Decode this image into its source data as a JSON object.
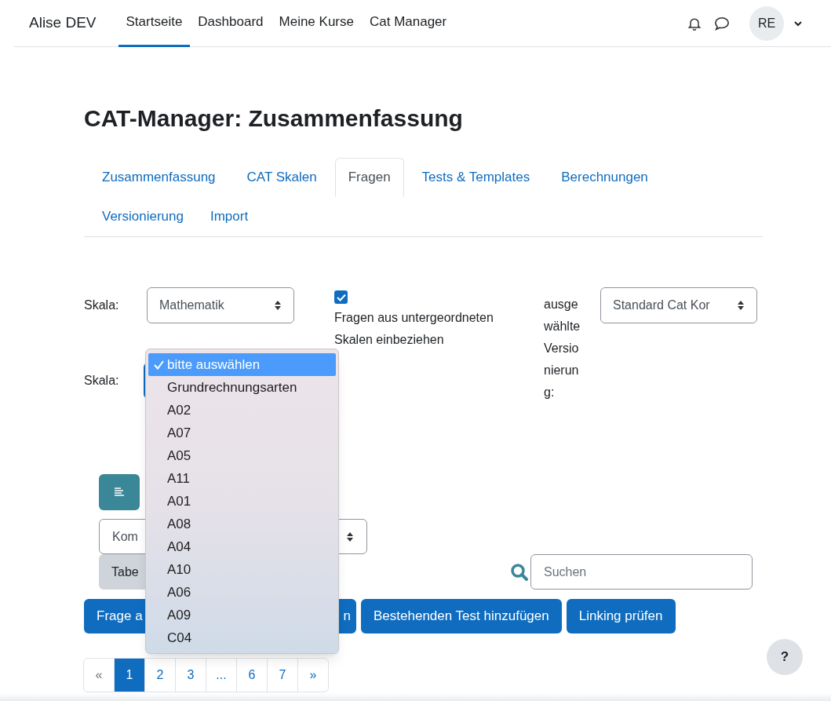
{
  "navbar": {
    "brand": "Alise DEV",
    "links": [
      {
        "label": "Startseite",
        "selected": true
      },
      {
        "label": "Dashboard",
        "selected": false
      },
      {
        "label": "Meine Kurse",
        "selected": false
      },
      {
        "label": "Cat Manager",
        "selected": false
      }
    ],
    "avatar": "RE"
  },
  "title": "CAT-Manager: Zusammenfassung",
  "tabs": [
    {
      "label": "Zusammenfassung",
      "selected": false
    },
    {
      "label": "CAT Skalen",
      "selected": false
    },
    {
      "label": "Fragen",
      "selected": true
    },
    {
      "label": "Tests & Templates",
      "selected": false
    },
    {
      "label": "Berechnungen",
      "selected": false
    },
    {
      "label": "Versionierung",
      "selected": false
    },
    {
      "label": "Import",
      "selected": false
    }
  ],
  "filters": {
    "scale_label": "Skala:",
    "scale_select": "Mathematik",
    "include_children": {
      "checked": true,
      "label": "Fragen aus untergeordneten Skalen einbeziehen"
    },
    "version_label": "ausgewählte Versionierung:",
    "version_select": "Standard Cat Kor",
    "subscale_label": "Skala:"
  },
  "dropdown": {
    "options": [
      {
        "label": "bitte auswählen",
        "selected": true
      },
      {
        "label": "Grundrechnungsarten",
        "selected": false
      },
      {
        "label": "A02",
        "selected": false
      },
      {
        "label": "A07",
        "selected": false
      },
      {
        "label": "A05",
        "selected": false
      },
      {
        "label": "A11",
        "selected": false
      },
      {
        "label": "A01",
        "selected": false
      },
      {
        "label": "A08",
        "selected": false
      },
      {
        "label": "A04",
        "selected": false
      },
      {
        "label": "A10",
        "selected": false
      },
      {
        "label": "A06",
        "selected": false
      },
      {
        "label": "A09",
        "selected": false
      },
      {
        "label": "C04",
        "selected": false
      }
    ]
  },
  "table_controls": {
    "column_select": "Kom",
    "table_button": "Tabe",
    "search_placeholder": "Suchen"
  },
  "actions": [
    {
      "parts": [
        "Frage a",
        "n"
      ]
    },
    {
      "parts": [
        "Bestehenden Test hinzufügen"
      ]
    },
    {
      "parts": [
        "Linking prüfen"
      ]
    }
  ],
  "pagination": [
    {
      "label": "«",
      "selected": false
    },
    {
      "label": "1",
      "selected": true
    },
    {
      "label": "2",
      "selected": false
    },
    {
      "label": "3",
      "selected": false
    },
    {
      "label": "...",
      "selected": false
    },
    {
      "label": "6",
      "selected": false
    },
    {
      "label": "7",
      "selected": false
    },
    {
      "label": "»",
      "selected": false
    }
  ],
  "help": "?"
}
